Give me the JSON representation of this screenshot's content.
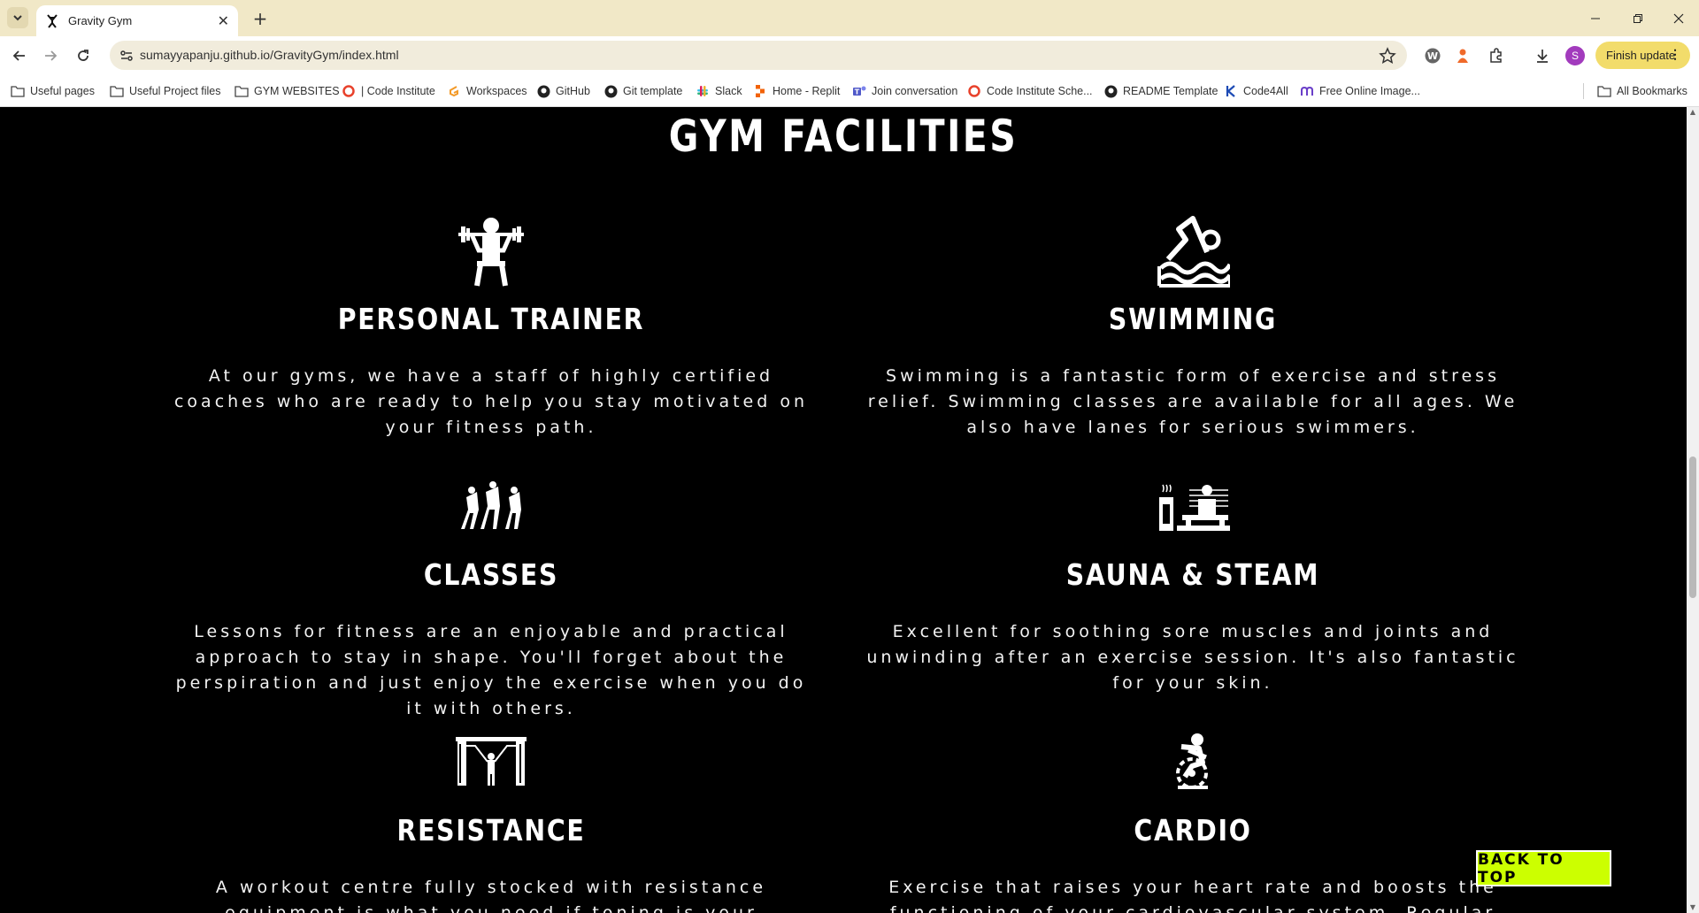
{
  "browser": {
    "tab_title": "Gravity Gym",
    "url": "sumayyapanju.github.io/GravityGym/index.html",
    "profile_initial": "S",
    "finish_update_label": "Finish update",
    "bookmarks": [
      {
        "label": "Useful pages",
        "icon": "folder-icon"
      },
      {
        "label": "Useful Project files",
        "icon": "folder-icon"
      },
      {
        "label": "GYM WEBSITES",
        "icon": "folder-icon"
      },
      {
        "label": "| Code Institute",
        "icon": "code-institute-icon"
      },
      {
        "label": "Workspaces",
        "icon": "gitpod-icon"
      },
      {
        "label": "GitHub",
        "icon": "github-icon"
      },
      {
        "label": "Git template",
        "icon": "github-icon"
      },
      {
        "label": "Slack",
        "icon": "slack-icon"
      },
      {
        "label": "Home - Replit",
        "icon": "replit-icon"
      },
      {
        "label": "Join conversation",
        "icon": "teams-icon"
      },
      {
        "label": "Code Institute Sche...",
        "icon": "code-institute-icon"
      },
      {
        "label": "README Template",
        "icon": "github-icon"
      },
      {
        "label": "Code4All",
        "icon": "code4all-icon"
      },
      {
        "label": "Free Online Image...",
        "icon": "image-tool-icon"
      }
    ],
    "all_bookmarks_label": "All Bookmarks",
    "colors": {
      "tabbar": "#f1e8c7",
      "finish_update": "#f2dc6b",
      "avatar": "#a23bbd"
    }
  },
  "page": {
    "heading": "GYM FACILITIES",
    "facilities": [
      {
        "title": "PERSONAL TRAINER",
        "icon": "weightlifting-icon",
        "text": "At our gyms, we have a staff of highly certified coaches who are ready to help you stay motivated on your fitness path."
      },
      {
        "title": "SWIMMING",
        "icon": "swimmer-icon",
        "text": "Swimming is a fantastic form of exercise and stress relief. Swimming classes are available for all ages. We also have lanes for serious swimmers."
      },
      {
        "title": "CLASSES",
        "icon": "group-class-icon",
        "text": "Lessons for fitness are an enjoyable and practical approach to stay in shape. You'll forget about the perspiration and just enjoy the exercise when you do it with others."
      },
      {
        "title": "SAUNA & STEAM",
        "icon": "sauna-icon",
        "text": "Excellent for soothing sore muscles and joints and unwinding after an exercise session. It's also fantastic for your skin."
      },
      {
        "title": "RESISTANCE",
        "icon": "resistance-machine-icon",
        "text": "A workout centre fully stocked with resistance equipment is what you need if toning is your objective. To enhance"
      },
      {
        "title": "CARDIO",
        "icon": "exercise-bike-icon",
        "text": "Exercise that raises your heart rate and boosts the functioning of your cardiovascular system. Regular"
      }
    ],
    "back_to_top_label": "BACK TO TOP",
    "colors": {
      "background": "#000000",
      "text": "#ffffff",
      "button": "#ccff00"
    }
  }
}
